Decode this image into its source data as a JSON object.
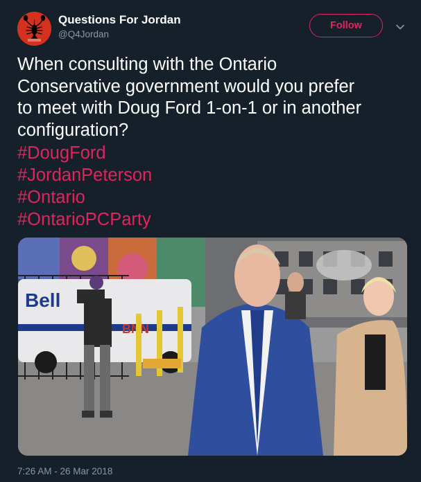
{
  "author": {
    "display_name": "Questions For Jordan",
    "handle": "@Q4Jordan",
    "avatar_icon": "lobster-logo-icon",
    "avatar_color": "#d4321f"
  },
  "follow_label": "Follow",
  "tweet": {
    "text_lines": [
      "When consulting with the Ontario",
      "Conservative government would you prefer",
      "to meet with Doug Ford 1-on-1 or in another",
      "configuration?"
    ],
    "hashtags": [
      "#DougFord",
      "#JordanPeterson",
      "#Ontario",
      "#OntarioPCParty"
    ]
  },
  "photo_sign_texts": [
    "Bell",
    "BNN"
  ],
  "timestamp": "7:26 AM - 26 Mar 2018",
  "colors": {
    "background": "#15202b",
    "accent": "#e0245e",
    "secondary_text": "#8899a6"
  }
}
